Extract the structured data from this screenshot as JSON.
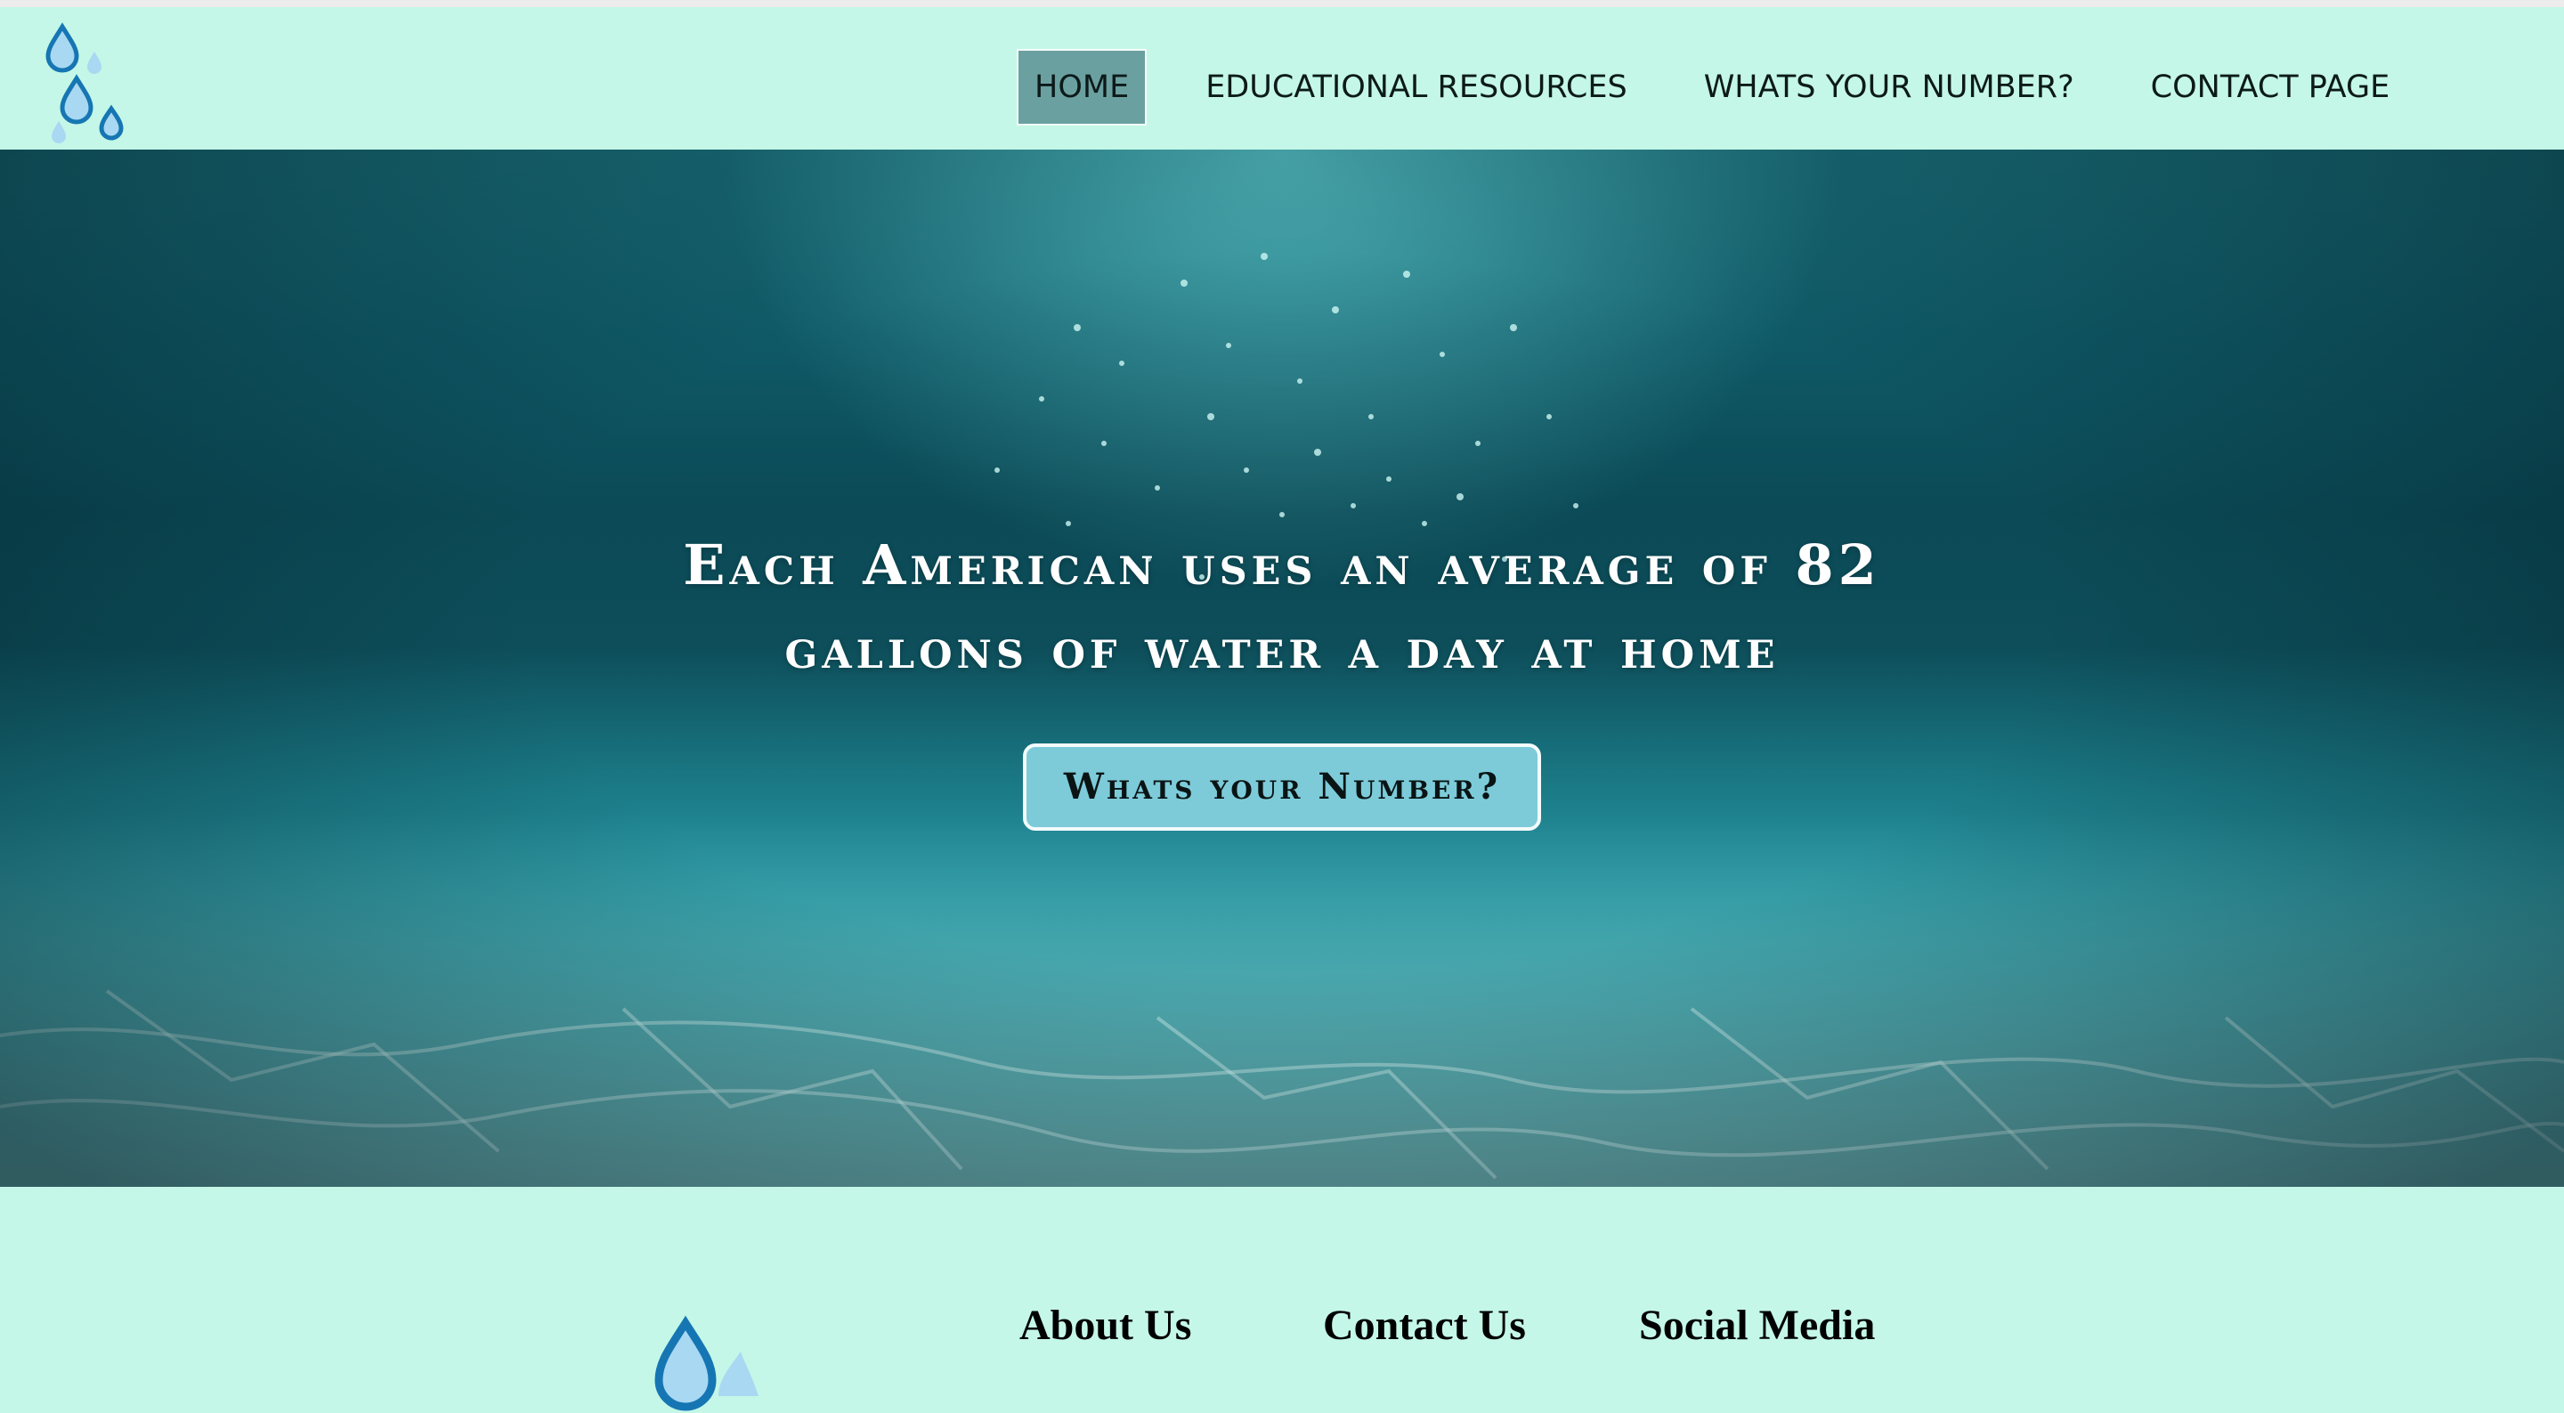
{
  "nav": {
    "items": [
      {
        "label": "HOME",
        "active": true
      },
      {
        "label": "EDUCATIONAL RESOURCES",
        "active": false
      },
      {
        "label": "WHATS YOUR NUMBER?",
        "active": false
      },
      {
        "label": "CONTACT PAGE",
        "active": false
      }
    ]
  },
  "hero": {
    "title_line1": "Each American uses an average of 82",
    "title_line2": "gallons of water a day at home",
    "cta_label": "Whats your Number?"
  },
  "footer": {
    "about": "About Us",
    "contact": "Contact Us",
    "social": "Social Media"
  },
  "colors": {
    "background": "#c4f7e7",
    "nav_active": "#6ba0a0",
    "cta": "#7dcbd9",
    "drop_dark": "#1676b3",
    "drop_light": "#a9d8f2"
  },
  "icons": {
    "logo": "water-drops-logo",
    "footer_logo": "water-drop-icon"
  }
}
